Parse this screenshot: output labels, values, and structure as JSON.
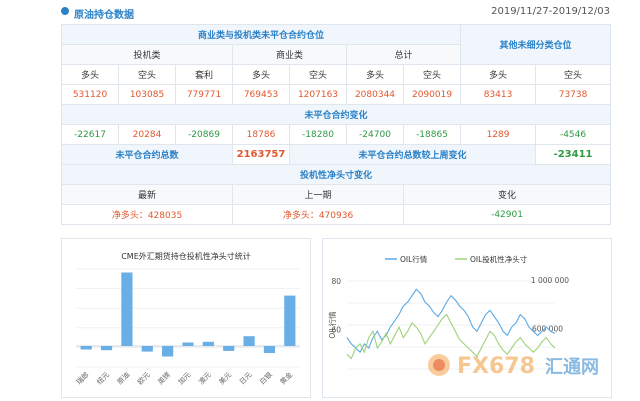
{
  "header": {
    "title": "原油持仓数据",
    "date_range": "2019/11/27-2019/12/03"
  },
  "table": {
    "group_title": "商业类与投机类未平仓合约仓位",
    "other_title": "其他未细分类仓位",
    "sub_groups": [
      "投机类",
      "商业类",
      "总计"
    ],
    "columns": [
      "多头",
      "空头",
      "套利",
      "多头",
      "空头",
      "多头",
      "空头",
      "多头",
      "空头"
    ],
    "positions": [
      "531120",
      "103085",
      "779771",
      "769453",
      "1207163",
      "2080344",
      "2090019",
      "83413",
      "73738"
    ],
    "change_title": "未平仓合约变化",
    "changes": [
      "-22617",
      "20284",
      "-20869",
      "18786",
      "-18280",
      "-24700",
      "-18865",
      "1289",
      "-4546"
    ],
    "total_label": "未平仓合约总数",
    "total_value": "2163757",
    "weekly_change_label": "未平仓合约总数较上周变化",
    "weekly_change_value": "-23411",
    "spec_title": "投机性净头寸变化",
    "spec_cols": [
      "最新",
      "上一期",
      "变化"
    ],
    "spec_latest": "净多头：428035",
    "spec_previous": "净多头：470936",
    "spec_change": "-42901"
  },
  "colors": {
    "accent": "#2c82c9",
    "up": "#e4572e",
    "down": "#2e9a43",
    "bar": "#6aaee6",
    "line_blue": "#5aa9e6",
    "line_green": "#9dd27a"
  },
  "chart_data": [
    {
      "type": "bar",
      "title": "CME外汇期货持仓投机性净头寸统计",
      "categories": [
        "瑞郎",
        "纽元",
        "原油",
        "欧元",
        "英镑",
        "加元",
        "澳元",
        "美元",
        "日元",
        "白银",
        "黄金"
      ],
      "values": [
        -5,
        -6,
        105,
        -8,
        -15,
        5,
        6,
        -7,
        14,
        -10,
        72
      ],
      "ylim": [
        -30,
        110
      ]
    },
    {
      "type": "line",
      "legend": [
        "OIL行情",
        "OIL投机性净头寸"
      ],
      "ylabel": "OIL行情",
      "left_ticks": [
        "80",
        "60"
      ],
      "right_ticks": [
        "1 000 000",
        "600 000"
      ],
      "legend_position": "top",
      "series": [
        {
          "name": "OIL行情",
          "values": [
            55,
            52,
            50,
            48,
            52,
            50,
            55,
            58,
            54,
            56,
            60,
            63,
            66,
            70,
            72,
            75,
            78,
            76,
            72,
            70,
            67,
            65,
            68,
            72,
            75,
            73,
            70,
            68,
            65,
            60,
            58,
            62,
            66,
            68,
            65,
            62,
            58,
            56,
            60,
            62,
            66,
            64,
            60,
            58,
            56,
            58,
            60,
            58,
            57
          ]
        },
        {
          "name": "OIL投机性净头寸",
          "values": [
            47,
            45,
            50,
            52,
            48,
            55,
            58,
            50,
            53,
            57,
            52,
            56,
            60,
            55,
            58,
            62,
            60,
            57,
            52,
            55,
            58,
            61,
            64,
            66,
            62,
            58,
            54,
            52,
            50,
            48,
            46,
            50,
            54,
            58,
            56,
            52,
            49,
            47,
            50,
            53,
            55,
            52,
            50,
            48,
            50,
            53,
            55,
            52,
            50
          ]
        }
      ]
    }
  ],
  "watermark": {
    "brand": "FX678",
    "sub": "汇通网"
  }
}
